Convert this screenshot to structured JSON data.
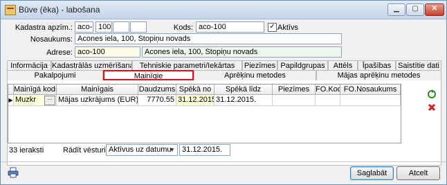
{
  "window": {
    "title": "Būve (ēka) - labošana"
  },
  "form": {
    "kadastra_label": "Kadastra apzīm.:",
    "kadastra_parts": [
      "aco-",
      "100",
      "",
      ""
    ],
    "kods_label": "Kods:",
    "kods_value": "aco-100",
    "aktivs_label": "Aktīvs",
    "aktivs_checked": "✓",
    "nosaukums_label": "Nosaukums:",
    "nosaukums_value": "Acones iela, 100, Stopiņu novads",
    "adrese_label": "Adrese:",
    "adrese_code": "aco-100",
    "adrese_text": "Acones iela, 100, Stopiņu novads"
  },
  "tabs_row1": [
    "Informācija",
    "Kadastrālās uzmērīšanas lietas",
    "Tehniskie parametri/Iekārtas",
    "Piezīmes",
    "Papildgrupas",
    "Attēls",
    "Īpašības",
    "Saistītie dati"
  ],
  "tabs_row2": [
    "Pakalpojumi",
    "Mainīgie",
    "Aprēķinu metodes",
    "Mājas aprēķinu metodes"
  ],
  "grid": {
    "headers": [
      "Mainīgā kods",
      "Mainīgais",
      "Daudzums",
      "Spēkā no",
      "Spēkā līdz",
      "Piezīmes",
      "FO.Kods",
      "FO.Nosaukums"
    ],
    "rows": [
      {
        "kods": "Muzkr",
        "lookup": "···",
        "mainigais": "Mājas uzkrājums (EUR)",
        "daudzums": "7770.55",
        "speka_no": "31.12.2015.",
        "speka_lidz": "31.12.2015.",
        "piezimes": "",
        "fo_kods": "",
        "fo_nosaukums": ""
      }
    ]
  },
  "status": {
    "count": "33 ieraksti",
    "history_label": "Rādīt vēsturi:",
    "history_value": "Aktīvus uz datumu",
    "history_date": "31.12.2015."
  },
  "buttons": {
    "save": "Saglabāt",
    "cancel": "Atcelt"
  }
}
